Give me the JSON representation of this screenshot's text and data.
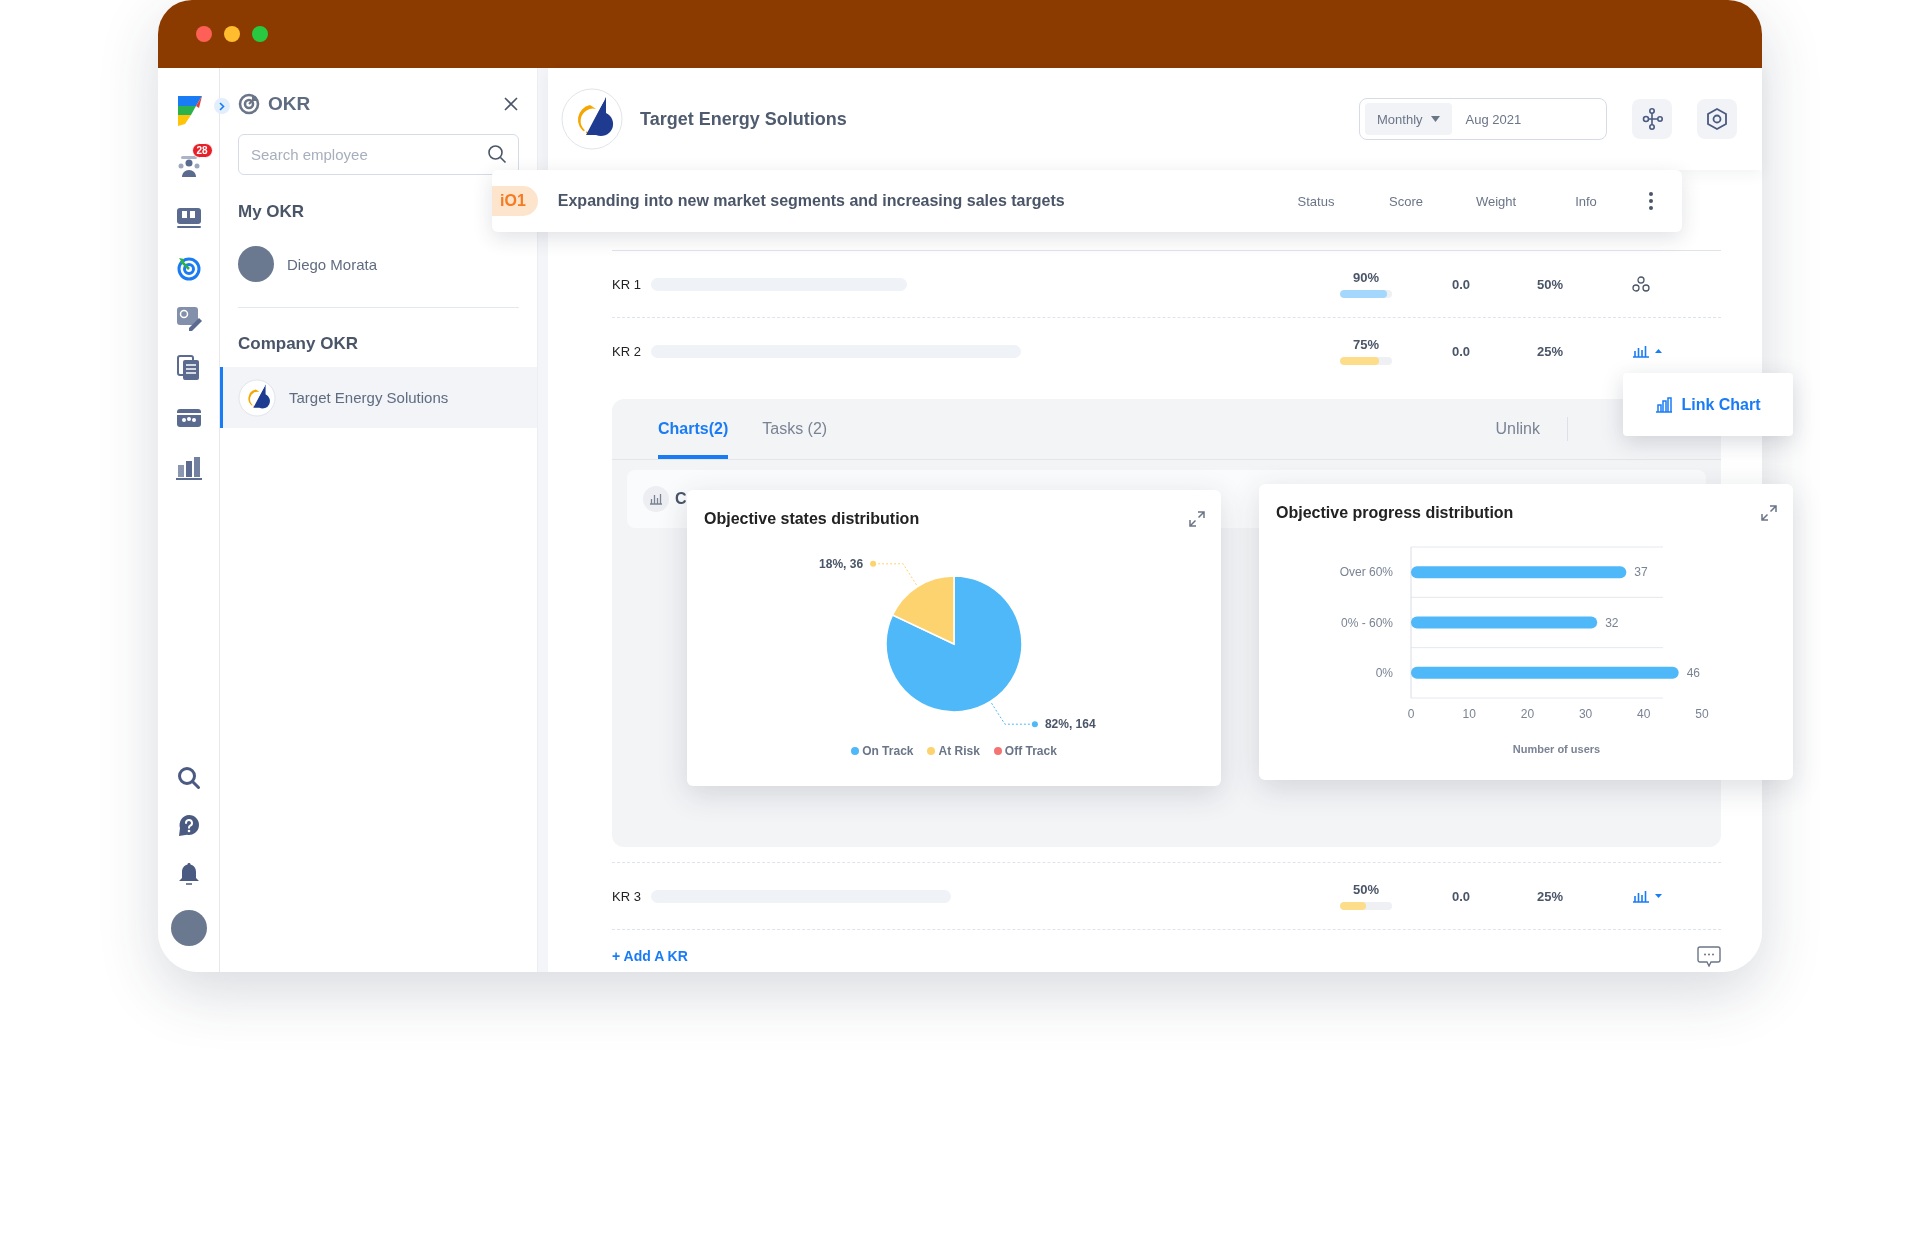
{
  "window": {
    "controls": [
      {
        "color": "#fe5f57"
      },
      {
        "color": "#febc2e"
      },
      {
        "color": "#28c840"
      }
    ]
  },
  "rail": {
    "top_items": [
      {
        "kind": "people",
        "badge": "28",
        "selected": false
      },
      {
        "kind": "board",
        "selected": false
      },
      {
        "kind": "target",
        "selected": true
      },
      {
        "kind": "edit",
        "selected": false
      },
      {
        "kind": "documents",
        "selected": false
      },
      {
        "kind": "calendar",
        "selected": false
      },
      {
        "kind": "chart",
        "selected": false
      }
    ],
    "bottom_items": [
      {
        "kind": "search"
      },
      {
        "kind": "help"
      },
      {
        "kind": "bell"
      }
    ]
  },
  "okr_panel": {
    "title": "OKR",
    "search": {
      "placeholder": "Search employee"
    },
    "my_okr": {
      "heading": "My OKR",
      "people": [
        {
          "name": "Diego Morata"
        }
      ]
    },
    "company_okr": {
      "heading": "Company OKR",
      "items": [
        {
          "name": "Target Energy Solutions",
          "selected": true
        }
      ]
    }
  },
  "header": {
    "company": "Target Energy Solutions",
    "period": {
      "type": "Monthly",
      "date": "Aug 2021"
    }
  },
  "objective": {
    "badge": "iO1",
    "title": "Expanding into new market segments and increasing sales targets",
    "columns": [
      "Status",
      "Score",
      "Weight",
      "Info"
    ]
  },
  "key_results": [
    {
      "name": "KR 1",
      "status": "90%",
      "level": 0.9,
      "color": "#a3d7fb",
      "score": "0.0",
      "weight": "50%",
      "info": {
        "kind": "network"
      }
    },
    {
      "name": "KR 2",
      "status": "75%",
      "level": 0.75,
      "color": "#fddc8a",
      "score": "0.0",
      "weight": "25%",
      "info": {
        "kind": "chart",
        "expanded": true
      },
      "details": {
        "tabs": [
          {
            "label": "Charts(2)",
            "selected": true
          },
          {
            "label": "Tasks (2)",
            "selected": false
          }
        ],
        "unlink": "Unlink",
        "strip_text": "C",
        "charts": [
          {
            "title": "Objective states distribution",
            "chart_data": {
              "type": "pie",
              "categories": [
                "On Track",
                "At Risk",
                "Off Track"
              ],
              "colors": [
                "#4fb8f8",
                "#fdd370",
                "#f47474"
              ],
              "values": [
                164,
                36,
                0
              ],
              "value_labels": [
                "82%, 164",
                "18%, 36",
                null
              ],
              "legend": true
            }
          },
          {
            "title": "Objective progress distribution",
            "chart_data": {
              "type": "bar",
              "orientation": "horizontal",
              "categories": [
                "Over 60%",
                "0% - 60%",
                "0%"
              ],
              "series": [
                {
                  "color": "#4fb8f8",
                  "values": [
                    37,
                    32,
                    46
                  ]
                }
              ],
              "xlabel": "Number of users",
              "xlim": [
                0,
                50
              ],
              "xticks": [
                0,
                10,
                20,
                30,
                40,
                50
              ],
              "data_labels": true
            }
          }
        ]
      }
    },
    {
      "name": "KR 3",
      "status": "50%",
      "level": 0.5,
      "color": "#fddc8a",
      "score": "0.0",
      "weight": "25%",
      "info": {
        "kind": "chart",
        "expanded": false
      }
    }
  ],
  "link_chart": {
    "label": "Link Chart"
  },
  "footer": {
    "add_label": "+ Add A KR"
  }
}
